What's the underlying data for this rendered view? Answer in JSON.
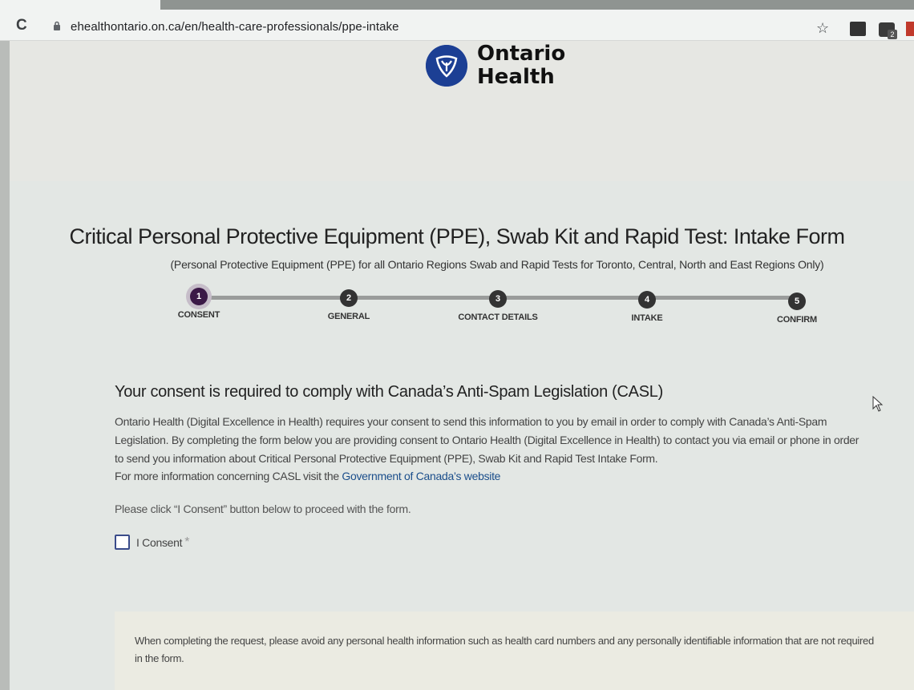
{
  "browser": {
    "url": "ehealthontario.on.ca/en/health-care-professionals/ppe-intake"
  },
  "logo": {
    "line1": "Ontario",
    "line2": "Health",
    "color": "#1c3f94"
  },
  "page": {
    "title": "Critical Personal Protective Equipment (PPE), Swab Kit and Rapid Test: Intake Form",
    "subtitle": "(Personal Protective Equipment (PPE) for all Ontario Regions Swab and Rapid Tests for Toronto, Central, North and East Regions Only)"
  },
  "stepper": {
    "steps": [
      {
        "number": "1",
        "label": "CONSENT"
      },
      {
        "number": "2",
        "label": "GENERAL"
      },
      {
        "number": "3",
        "label": "CONTACT DETAILS"
      },
      {
        "number": "4",
        "label": "INTAKE"
      },
      {
        "number": "5",
        "label": "CONFIRM"
      }
    ],
    "active_step": "1",
    "active_color": "#3b1947"
  },
  "consent_section": {
    "heading": "Your consent is required to comply with Canada’s Anti-Spam Legislation (CASL)",
    "body": "Ontario Health (Digital Excellence in Health) requires your consent to send this information to you by email in order to comply with Canada’s Anti-Spam Legislation. By completing the form below you are providing consent to Ontario Health (Digital Excellence in Health) to contact you via email or phone in order to send you information about Critical Personal Protective Equipment (PPE), Swab Kit and Rapid Test Intake Form.",
    "more_info_prefix": "For more information concerning CASL visit the ",
    "more_info_link": "Government of Canada’s website",
    "instruction": "Please click “I Consent” button below to proceed with the form.",
    "checkbox_label": "I Consent",
    "required_marker": "*"
  },
  "notice": {
    "text": "When completing the request, please avoid any personal health information such as health card numbers and any personally identifiable information that are not required in the form."
  }
}
